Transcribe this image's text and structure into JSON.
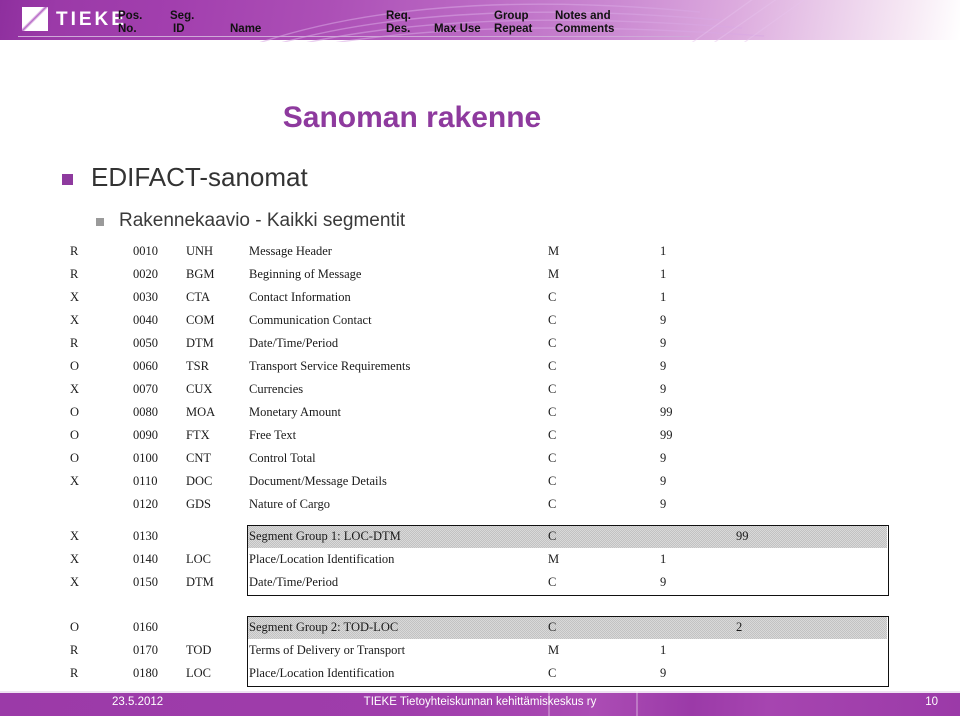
{
  "header": {
    "logo_text": "TIEKE",
    "columns": [
      {
        "line1": "Pos.",
        "line2": "No."
      },
      {
        "line1": "Seg.",
        "line2": "ID"
      },
      {
        "line1": "",
        "line2": "Name"
      },
      {
        "line1": "Req.",
        "line2": "Des."
      },
      {
        "line1": "",
        "line2": "Max Use"
      },
      {
        "line1": "Group",
        "line2": "Repeat"
      },
      {
        "line1": "Notes and",
        "line2": "Comments"
      }
    ]
  },
  "slide": {
    "title": "Sanoman rakenne",
    "bullet_level1": "EDIFACT-sanomat",
    "bullet_level2": "Rakennekaavio - Kaikki segmentit"
  },
  "table": {
    "headers": [
      "Req. Des.",
      "Pos. No.",
      "Seg. ID",
      "Name",
      "Req. Des.",
      "Max Use",
      "Group Repeat"
    ],
    "rows": [
      {
        "req": "R",
        "pos": "0010",
        "seg": "UNH",
        "name": "Message Header",
        "des": "M",
        "max": "1",
        "grp": "",
        "group": false
      },
      {
        "req": "R",
        "pos": "0020",
        "seg": "BGM",
        "name": "Beginning of Message",
        "des": "M",
        "max": "1",
        "grp": "",
        "group": false
      },
      {
        "req": "X",
        "pos": "0030",
        "seg": "CTA",
        "name": "Contact Information",
        "des": "C",
        "max": "1",
        "grp": "",
        "group": false
      },
      {
        "req": "X",
        "pos": "0040",
        "seg": "COM",
        "name": "Communication Contact",
        "des": "C",
        "max": "9",
        "grp": "",
        "group": false
      },
      {
        "req": "R",
        "pos": "0050",
        "seg": "DTM",
        "name": "Date/Time/Period",
        "des": "C",
        "max": "9",
        "grp": "",
        "group": false
      },
      {
        "req": "O",
        "pos": "0060",
        "seg": "TSR",
        "name": "Transport Service Requirements",
        "des": "C",
        "max": "9",
        "grp": "",
        "group": false
      },
      {
        "req": "X",
        "pos": "0070",
        "seg": "CUX",
        "name": "Currencies",
        "des": "C",
        "max": "9",
        "grp": "",
        "group": false
      },
      {
        "req": "O",
        "pos": "0080",
        "seg": "MOA",
        "name": "Monetary Amount",
        "des": "C",
        "max": "99",
        "grp": "",
        "group": false
      },
      {
        "req": "O",
        "pos": "0090",
        "seg": "FTX",
        "name": "Free Text",
        "des": "C",
        "max": "99",
        "grp": "",
        "group": false
      },
      {
        "req": "O",
        "pos": "0100",
        "seg": "CNT",
        "name": "Control Total",
        "des": "C",
        "max": "9",
        "grp": "",
        "group": false
      },
      {
        "req": "X",
        "pos": "0110",
        "seg": "DOC",
        "name": "Document/Message Details",
        "des": "C",
        "max": "9",
        "grp": "",
        "group": false
      },
      {
        "req": "",
        "pos": "0120",
        "seg": "GDS",
        "name": "Nature of Cargo",
        "des": "C",
        "max": "9",
        "grp": "",
        "group": false
      },
      {
        "req": "X",
        "pos": "0130",
        "seg": "",
        "name": "Segment Group 1: LOC-DTM",
        "des": "C",
        "max": "",
        "grp": "99",
        "group": true
      },
      {
        "req": "X",
        "pos": "0140",
        "seg": "LOC",
        "name": "Place/Location Identification",
        "des": "M",
        "max": "1",
        "grp": "",
        "group": false
      },
      {
        "req": "X",
        "pos": "0150",
        "seg": "DTM",
        "name": "Date/Time/Period",
        "des": "C",
        "max": "9",
        "grp": "",
        "group": false
      },
      {
        "req": "O",
        "pos": "0160",
        "seg": "",
        "name": "Segment Group 2: TOD-LOC",
        "des": "C",
        "max": "",
        "grp": "2",
        "group": true
      },
      {
        "req": "R",
        "pos": "0170",
        "seg": "TOD",
        "name": "Terms of Delivery or Transport",
        "des": "M",
        "max": "1",
        "grp": "",
        "group": false
      },
      {
        "req": "R",
        "pos": "0180",
        "seg": "LOC",
        "name": "Place/Location Identification",
        "des": "C",
        "max": "9",
        "grp": "",
        "group": false
      }
    ]
  },
  "footer": {
    "date": "23.5.2012",
    "organization": "TIEKE  Tietoyhteiskunnan kehittämiskeskus ry",
    "page_number": "10"
  },
  "colors": {
    "brand_purple": "#8e3a9e",
    "header_purple": "#9b3aa8",
    "bullet_gray": "#9a9a9a",
    "group_shade": "#d9d9d9"
  }
}
